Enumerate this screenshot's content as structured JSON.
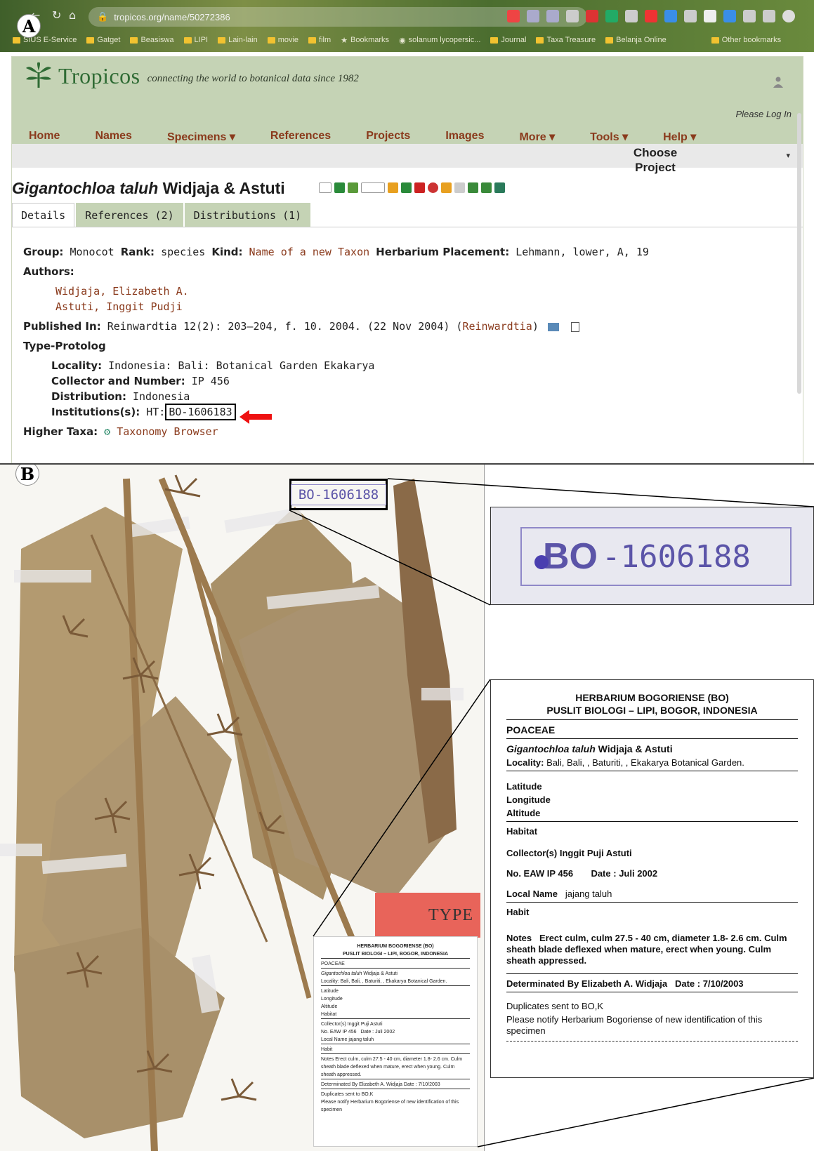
{
  "panel_a": {
    "label": "A",
    "browser": {
      "url": "tropicos.org/name/50272386",
      "bookmarks": [
        "SIUS E-Service",
        "Gatget",
        "Beasiswa",
        "LIPI",
        "Lain-lain",
        "movie",
        "film",
        "Bookmarks",
        "solanum lycopersic...",
        "Journal",
        "Taxa Treasure",
        "Belanja Online",
        "Other bookmarks"
      ]
    },
    "site": {
      "brand": "Tropicos",
      "tagline": "connecting the world to botanical data since 1982",
      "login": "Please Log In",
      "menu": [
        "Home",
        "Names",
        "Specimens ▾",
        "References",
        "Projects",
        "Images",
        "More ▾",
        "Tools ▾",
        "Help ▾"
      ],
      "choose_project": "Choose Project",
      "choose_arrow": "▾"
    },
    "name": {
      "genus_species": "Gigantochloa taluh",
      "authors": "Widjaja & Astuti"
    },
    "tabs": [
      "Details",
      "References (2)",
      "Distributions (1)"
    ],
    "details": {
      "group_label": "Group:",
      "group": "Monocot",
      "rank_label": "Rank:",
      "rank": "species",
      "kind_label": "Kind:",
      "kind": "Name of a new Taxon",
      "placement_label": "Herbarium Placement:",
      "placement": "Lehmann, lower, A, 19",
      "authors_label": "Authors:",
      "authors": [
        "Widjaja, Elizabeth A.",
        "Astuti, Inggit Pudji"
      ],
      "published_label": "Published In:",
      "published": "Reinwardtia 12(2): 203–204, f. 10. 2004. (22 Nov 2004)",
      "published_journal": "Reinwardtia",
      "type_protolog": "Type-Protolog",
      "locality_label": "Locality:",
      "locality": "Indonesia: Bali: Botanical Garden Ekakarya",
      "collector_label": "Collector and Number:",
      "collector": "IP 456",
      "distribution_label": "Distribution:",
      "distribution": "Indonesia",
      "institutions_label": "Institutions(s):",
      "institutions_prefix": "HT:",
      "institutions_id": "BO-1606183",
      "higher_taxa_label": "Higher Taxa:",
      "higher_taxa": "Taxonomy Browser"
    }
  },
  "panel_b": {
    "label": "B",
    "stamp": "BO-1606188",
    "stamp_bo": "BO",
    "stamp_num": "-1606188",
    "type_label": "TYPE",
    "herbarium_label": {
      "head1": "HERBARIUM BOGORIENSE (BO)",
      "head2": "PUSLIT BIOLOGI – LIPI, BOGOR, INDONESIA",
      "family": "POACEAE",
      "taxon_italic": "Gigantochloa taluh",
      "taxon_author": "Widjaja & Astuti",
      "locality_label": "Locality:",
      "locality": "Bali, Bali, , Baturiti, , Ekakarya Botanical Garden.",
      "latitude": "Latitude",
      "longitude": "Longitude",
      "altitude": "Altitude",
      "habitat": "Habitat",
      "collector_label": "Collector(s)",
      "collector": "Inggit Puji Astuti",
      "number_label": "No. EAW IP 456",
      "date_label": "Date :",
      "date": "Juli 2002",
      "local_name_label": "Local Name",
      "local_name": "jajang taluh",
      "habit": "Habit",
      "notes_label": "Notes",
      "notes": "Erect culm, culm 27.5 - 40 cm, diameter 1.8- 2.6 cm. Culm sheath blade deflexed when mature, erect when young. Culm sheath appressed.",
      "determined": "Determinated By Elizabeth A. Widjaja",
      "determined_date": "Date : 7/10/2003",
      "duplicates": "Duplicates sent to  BO,K",
      "notify": "Please notify Herbarium Bogoriense of new identification of this specimen"
    }
  },
  "colors": {
    "header_green": "#c5d3b5",
    "link": "#8a3a1c",
    "stamp_ink": "#5b54a8",
    "type_red": "#e8645a"
  }
}
